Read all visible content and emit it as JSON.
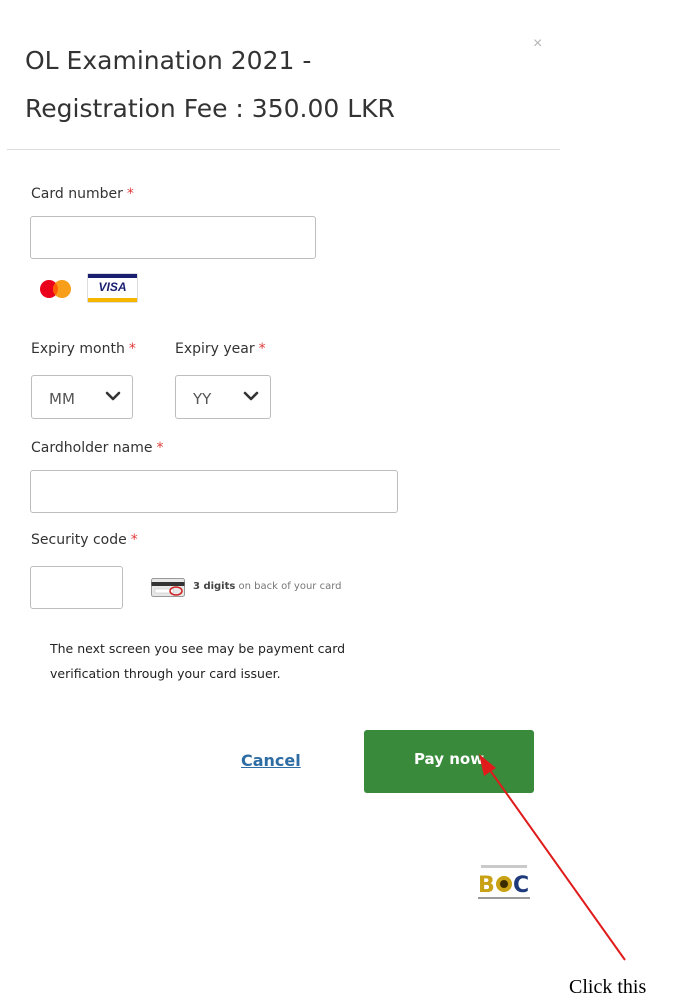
{
  "header": {
    "title_line1": "OL Examination 2021 -",
    "title_line2": "Registration Fee : 350.00 LKR",
    "close_symbol": "×"
  },
  "form": {
    "card_number": {
      "label": "Card number",
      "required_mark": "*",
      "value": ""
    },
    "card_brands": [
      "mastercard",
      "VISA"
    ],
    "expiry_month": {
      "label": "Expiry month",
      "required_mark": "*",
      "selected": "MM"
    },
    "expiry_year": {
      "label": "Expiry year",
      "required_mark": "*",
      "selected": "YY"
    },
    "cardholder": {
      "label": "Cardholder name",
      "required_mark": "*",
      "value": ""
    },
    "security_code": {
      "label": "Security code",
      "required_mark": "*",
      "value": "",
      "hint_bold": "3 digits",
      "hint_rest": " on back of your card"
    }
  },
  "notice": {
    "line1": "The next screen you see may be payment card",
    "line2": "verification through your card issuer."
  },
  "actions": {
    "cancel_label": "Cancel",
    "pay_label": "Pay now"
  },
  "annotation": {
    "text": "Click this"
  },
  "colors": {
    "pay_button": "#3a8a3c",
    "required": "#e03a3a",
    "link": "#2e6da4",
    "arrow": "#e01b1b"
  }
}
